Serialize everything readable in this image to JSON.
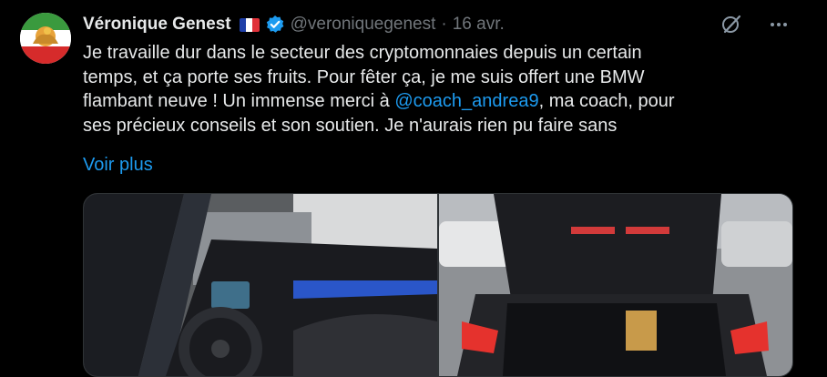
{
  "author": {
    "name": "Véronique Genest",
    "handle": "@veroniquegenest",
    "separator": "·",
    "date": "16 avr."
  },
  "tweet": {
    "line1": "Je travaille dur dans le secteur des cryptomonnaies depuis un certain",
    "line2": "temps, et ça porte ses fruits. Pour fêter ça, je me suis offert une BMW",
    "line3_before": "flambant neuve ! Un immense merci à ",
    "mention": "@coach_andrea9",
    "line3_after": ", ma coach, pour",
    "line4": "ses précieux conseils et son soutien. Je n'aurais rien pu faire sans",
    "show_more": "Voir plus"
  },
  "icons": {
    "verified": "verified-badge-icon",
    "grok": "grok-icon",
    "more": "more-icon",
    "flag": "france-flag-icon"
  },
  "colors": {
    "background": "#000000",
    "text": "#e7e9ea",
    "secondary": "#71767b",
    "accent": "#1d9bf0"
  }
}
